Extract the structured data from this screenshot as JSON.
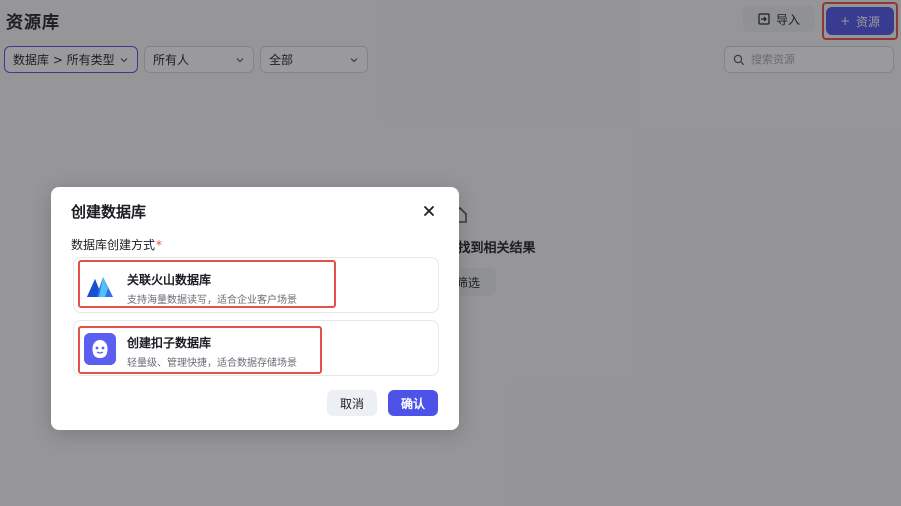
{
  "page": {
    "title": "资源库",
    "import_label": "导入",
    "add_label": "资源",
    "filters": [
      "数据库 > 所有类型",
      "所有人",
      "全部"
    ],
    "search_placeholder": "搜索资源",
    "empty_title": "能找到相关结果",
    "empty_button": "筛选"
  },
  "modal": {
    "title": "创建数据库",
    "field_label": "数据库创建方式",
    "required_mark": "*",
    "options": [
      {
        "title": "关联火山数据库",
        "desc": "支持海量数据读写，适合企业客户场景",
        "icon": "volcano-logo-icon"
      },
      {
        "title": "创建扣子数据库",
        "desc": "轻量级、管理快捷，适合数据存储场景",
        "icon": "coze-logo-icon"
      }
    ],
    "cancel_label": "取消",
    "confirm_label": "确认"
  },
  "colors": {
    "primary": "#4d53e8",
    "highlight": "#e4514b"
  }
}
